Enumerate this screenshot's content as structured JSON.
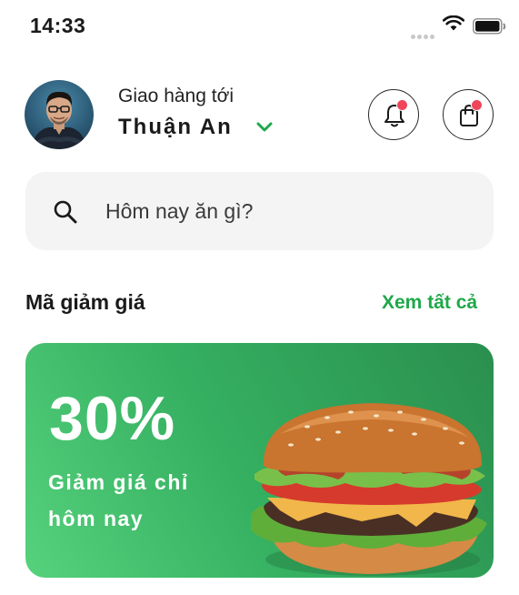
{
  "status_bar": {
    "time": "14:33"
  },
  "header": {
    "deliver_label": "Giao hàng tới",
    "location": "Thuận An"
  },
  "search": {
    "placeholder": "Hôm nay ăn gì?"
  },
  "vouchers": {
    "title": "Mã giảm giá",
    "see_all": "Xem tất cả"
  },
  "promo": {
    "percent": "30%",
    "line1": "Giảm giá chỉ",
    "line2": "hôm nay"
  },
  "colors": {
    "accent": "#1fa84a",
    "notification_dot": "#f0465a",
    "search_bg": "#f4f4f5"
  },
  "icons": [
    "wifi-icon",
    "battery-icon",
    "chevron-down-icon",
    "bell-icon",
    "shopping-bag-icon",
    "search-icon"
  ]
}
